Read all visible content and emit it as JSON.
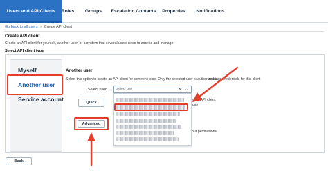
{
  "tabs": [
    {
      "label": "Users and API Clients",
      "active": true
    },
    {
      "label": "Roles",
      "active": false
    },
    {
      "label": "Groups",
      "active": false
    },
    {
      "label": "Escalation Contacts",
      "active": false
    },
    {
      "label": "Properties",
      "active": false
    },
    {
      "label": "Notifications",
      "active": false
    }
  ],
  "breadcrumb": {
    "link": "Go back to all users",
    "separator": ">",
    "current": "Create API client"
  },
  "page": {
    "title": "Create API client",
    "description": "Create an API client for yourself, another user, or a system that several users need to access and manage.",
    "section_label": "Select API client type"
  },
  "client_types": [
    {
      "label": "Myself",
      "selected": false
    },
    {
      "label": "Another user",
      "selected": true
    },
    {
      "label": "Service account",
      "selected": false
    }
  ],
  "detail": {
    "title": "Another user",
    "description": "Select this option to create an API client for someone else. Only the selected user is authorized to",
    "description_right": "manage credentials for this client",
    "select_label": "Select user",
    "select_placeholder": "Select one",
    "clear_glyph": "✕",
    "chevron_glyph": "⌄",
    "quick_button": "Quick",
    "advanced_button": "Advanced",
    "side_text_1": "e the API client:",
    "side_text_2": "use",
    "side_text_3": "our permissions"
  },
  "footer": {
    "back_button": "Back"
  },
  "colors": {
    "accent": "#2b72c5",
    "annotation_red": "#e53d2b"
  }
}
